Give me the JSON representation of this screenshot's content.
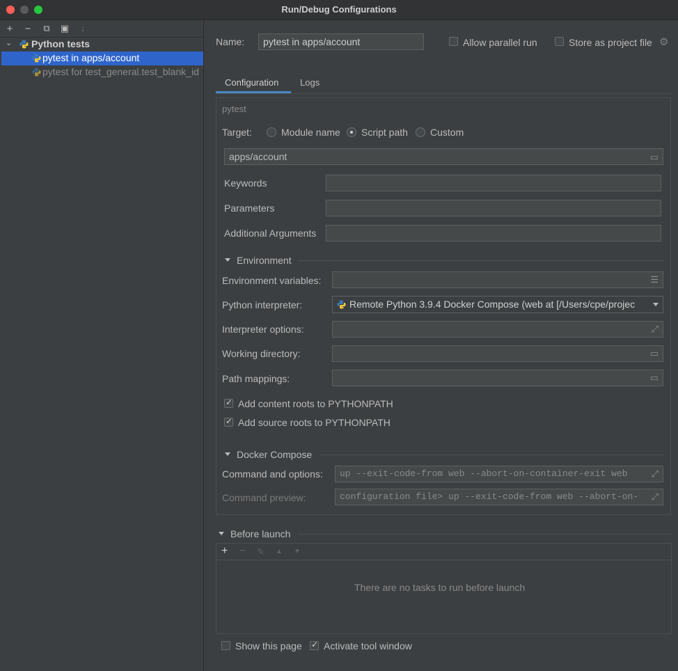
{
  "window": {
    "title": "Run/Debug Configurations",
    "traffic_lights": [
      "#ff5f57",
      "#5a5a5a",
      "#28c840"
    ]
  },
  "left_toolbar": {
    "add": "+",
    "remove": "−",
    "copy": "⧉",
    "folder": "▣",
    "sort": "↓"
  },
  "tree": {
    "group_label": "Python tests",
    "items": [
      {
        "label": "pytest in apps/account",
        "selected": true
      },
      {
        "label": "pytest for test_general.test_blank_id"
      }
    ]
  },
  "header": {
    "name_label": "Name:",
    "name_value": "pytest in apps/account",
    "allow_parallel_label": "Allow parallel run",
    "store_project_label": "Store as project file"
  },
  "tabs": [
    {
      "label": "Configuration"
    },
    {
      "label": "Logs"
    }
  ],
  "config": {
    "section_label": "pytest",
    "target_label": "Target:",
    "target_options": [
      "Module name",
      "Script path",
      "Custom"
    ],
    "script_path": "apps/account",
    "keywords_label": "Keywords",
    "parameters_label": "Parameters",
    "additional_args_label": "Additional Arguments",
    "environment": {
      "section_label": "Environment",
      "env_vars_label": "Environment variables:",
      "interpreter_label": "Python interpreter:",
      "interpreter_value": "Remote Python 3.9.4 Docker Compose (web at [/Users/cpe/projec",
      "interp_options_label": "Interpreter options:",
      "working_dir_label": "Working directory:",
      "path_mappings_label": "Path mappings:",
      "content_roots_label": "Add content roots to PYTHONPATH",
      "source_roots_label": "Add source roots to PYTHONPATH"
    },
    "docker": {
      "section_label": "Docker Compose",
      "command_label": "Command and options:",
      "command_value": "up --exit-code-from web --abort-on-container-exit web",
      "preview_label": "Command preview:",
      "preview_value": "configuration file> up --exit-code-from web --abort-on-"
    }
  },
  "before_launch": {
    "section_label": "Before launch",
    "empty_text": "There are no tasks to run before launch",
    "toolbar": {
      "add": "+",
      "remove": "−",
      "edit": "✎",
      "up": "▲",
      "down": "▼"
    }
  },
  "footer": {
    "show_page_label": "Show this page",
    "activate_tool_label": "Activate tool window"
  }
}
